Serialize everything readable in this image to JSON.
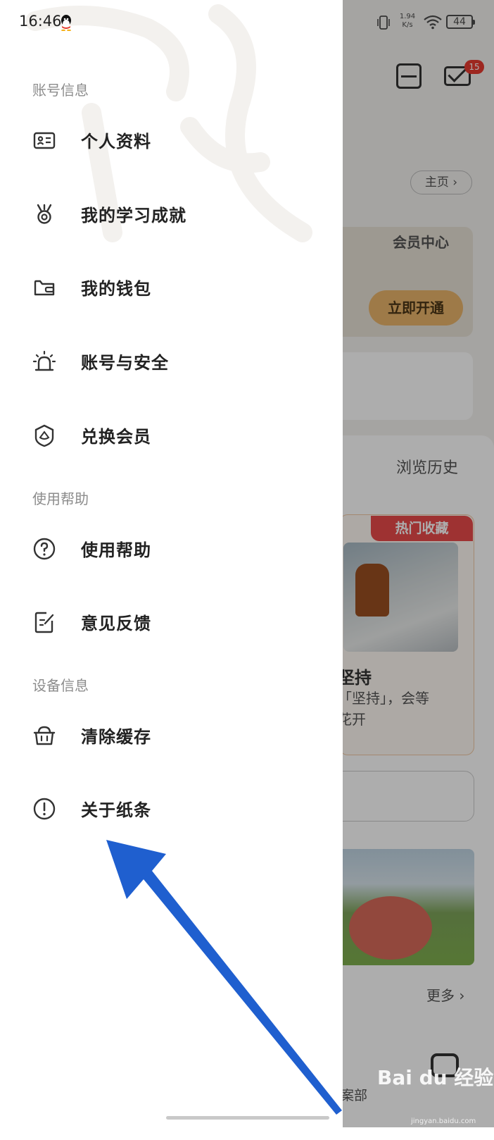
{
  "status_bar": {
    "time": "16:46",
    "net_speed_value": "1.94",
    "net_speed_unit": "K/s",
    "battery": "44"
  },
  "drawer": {
    "sections": [
      {
        "title": "账号信息",
        "items": [
          {
            "label": "个人资料",
            "icon": "id-card-icon"
          },
          {
            "label": "我的学习成就",
            "icon": "medal-icon"
          },
          {
            "label": "我的钱包",
            "icon": "wallet-icon"
          },
          {
            "label": "账号与安全",
            "icon": "alarm-light-icon"
          },
          {
            "label": "兑换会员",
            "icon": "shield-leaf-icon"
          }
        ]
      },
      {
        "title": "使用帮助",
        "items": [
          {
            "label": "使用帮助",
            "icon": "question-circle-icon"
          },
          {
            "label": "意见反馈",
            "icon": "feedback-edit-icon"
          }
        ]
      },
      {
        "title": "设备信息",
        "items": [
          {
            "label": "清除缓存",
            "icon": "basket-icon"
          },
          {
            "label": "关于纸条",
            "icon": "info-circle-icon"
          }
        ]
      }
    ]
  },
  "background_page": {
    "mail_badge": "15",
    "home_link": "主页 ›",
    "vip_title": "会员中心",
    "vip_button": "立即开通",
    "history_title": "浏览历史",
    "hot_tag": "热门收藏",
    "article_title": "坚持",
    "article_line1": "「坚持」，会等",
    "article_line2": "花开",
    "more_link": "更多 ›",
    "nav_label": "案部"
  },
  "watermark": {
    "logo": "Bai du 经验",
    "url": "jingyan.baidu.com"
  },
  "annotation": {
    "arrow_color": "#1f5fcf"
  }
}
